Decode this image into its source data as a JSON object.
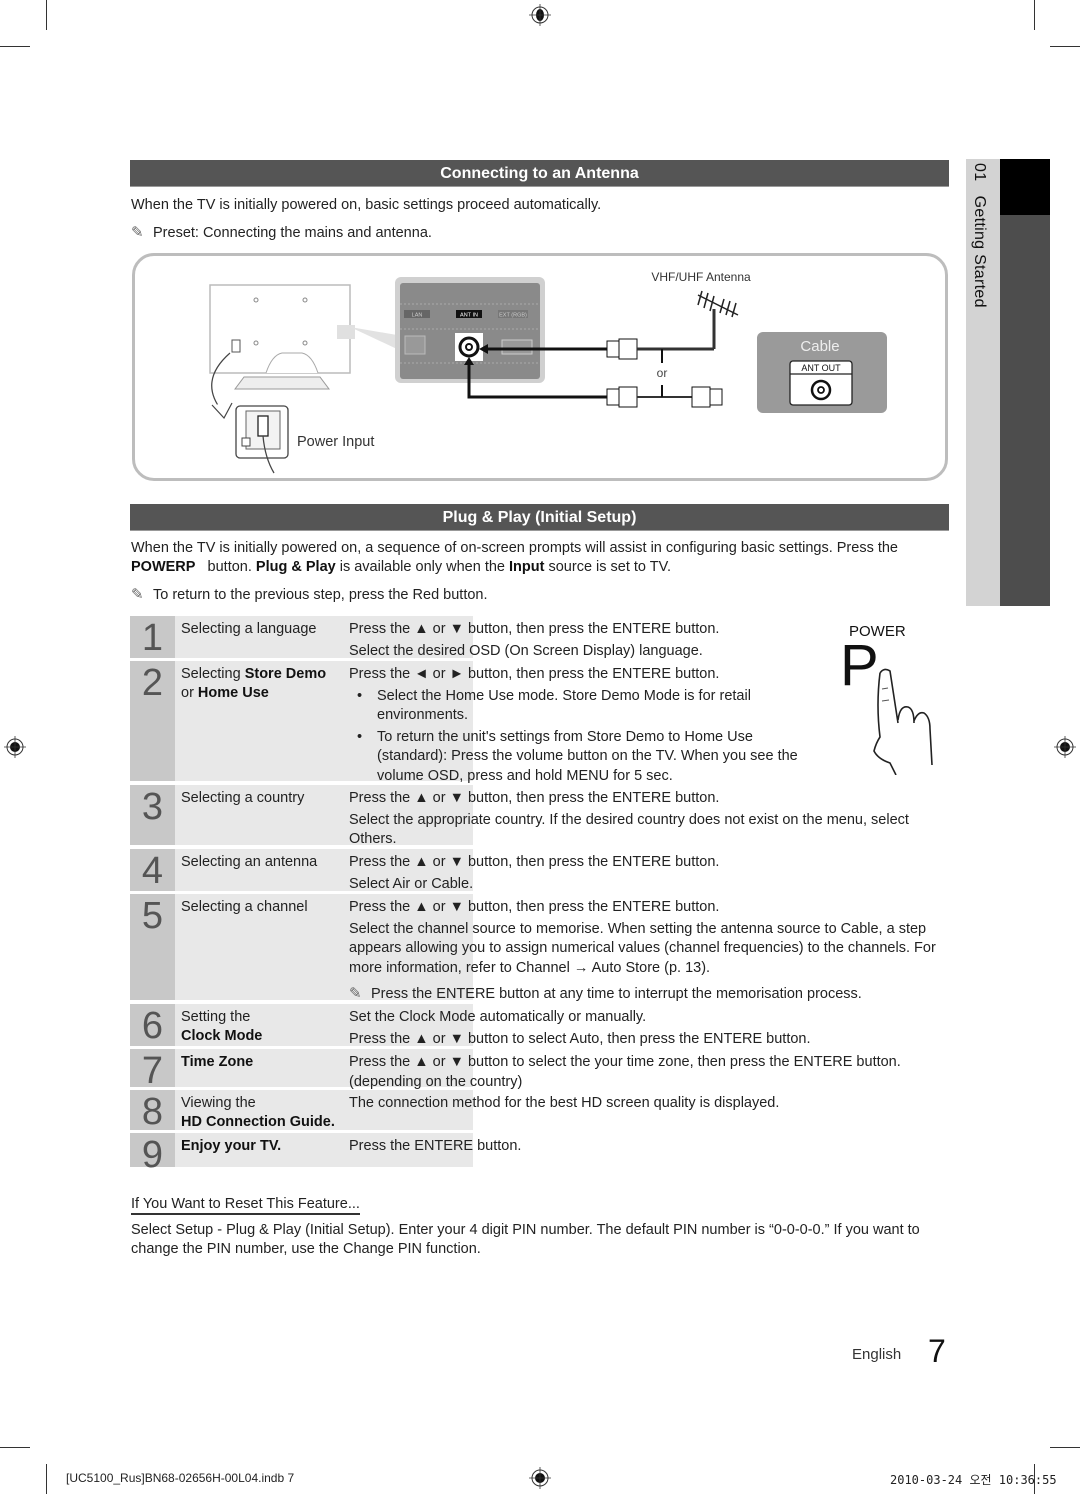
{
  "sidebar": {
    "chapter_number": "01",
    "chapter_title": "Getting Started"
  },
  "antenna_section": {
    "title": "Connecting to an Antenna",
    "intro": "When the TV is initially powered on, basic settings proceed automatically.",
    "note": "Preset: Connecting the mains and antenna.",
    "diagram": {
      "port_labels": [
        "LAN",
        "ANT IN",
        "EXT (RGB)"
      ],
      "antenna_label": "VHF/UHF Antenna",
      "or_label": "or",
      "cable_label": "Cable",
      "ant_out_label": "ANT OUT",
      "power_input_label": "Power Input"
    }
  },
  "plug_play_section": {
    "title": "Plug & Play (Initial Setup)",
    "intro_1": "When the TV is initially powered on, a sequence of on-screen prompts will assist in configuring basic settings. Press the",
    "intro_power": "POWERP",
    "intro_2": "button.",
    "intro_plug": "Plug & Play",
    "intro_3": "is available only when the",
    "intro_input": "Input",
    "intro_4": "source is set to TV.",
    "note": "To return to the previous step, press the Red button.",
    "power_label": "POWER",
    "power_glyph": "P"
  },
  "steps": [
    {
      "number": "1",
      "title": "Selecting a language",
      "lines": [
        "Press the ▲ or ▼ button, then press the ENTERE    button.",
        "Select the desired OSD (On Screen Display) language."
      ]
    },
    {
      "number": "2",
      "title_1": "Selecting ",
      "title_bold_1": "Store Demo",
      "title_2": "or ",
      "title_bold_2": "Home Use",
      "line": "Press the ◄ or ► button, then press the ENTERE    button.",
      "bullet_1": "Select the Home Use mode. Store Demo Mode is for retail environments.",
      "bullet_2": "To return the unit's settings from Store Demo to Home Use (standard): Press the volume button on the TV. When you see the volume OSD, press and hold MENU for 5 sec."
    },
    {
      "number": "3",
      "title": "Selecting a country",
      "lines": [
        "Press the ▲ or ▼ button, then press the ENTERE    button.",
        "Select the appropriate country. If the desired country does not exist on the menu, select Others."
      ]
    },
    {
      "number": "4",
      "title": "Selecting an antenna",
      "lines": [
        "Press the ▲ or ▼ button, then press the ENTERE    button.",
        "Select Air or Cable."
      ]
    },
    {
      "number": "5",
      "title": "Selecting a channel",
      "lines": [
        "Press the ▲ or ▼ button, then press the ENTERE    button.",
        "Select the channel source to memorise. When setting the antenna source to Cable, a step appears allowing you to assign numerical values (channel frequencies) to the channels. For more information, refer to Channel → Auto Store (p. 13)."
      ],
      "note": "Press the ENTERE    button at any time to interrupt the memorisation process."
    },
    {
      "number": "6",
      "title_1": "Setting the",
      "title_bold": "Clock Mode",
      "lines": [
        "Set the Clock Mode automatically or manually.",
        "Press the ▲ or ▼ button to select Auto, then press the ENTERE    button."
      ]
    },
    {
      "number": "7",
      "title_bold": "Time Zone",
      "lines": [
        "Press the ▲ or ▼ button to select the your time zone, then press the ENTERE    button. (depending on the country)"
      ]
    },
    {
      "number": "8",
      "title_1": "Viewing the",
      "title_bold": "HD Connection Guide.",
      "lines": [
        "The connection method for the best HD screen quality is displayed."
      ]
    },
    {
      "number": "9",
      "title_bold": "Enjoy your TV.",
      "lines": [
        "Press the ENTERE    button."
      ]
    }
  ],
  "reset": {
    "heading": "If You Want to Reset This Feature...",
    "text": "Select Setup - Plug & Play (Initial Setup). Enter your 4 digit PIN number. The default PIN number is “0-0-0-0.” If you want to change the PIN number, use the Change PIN function."
  },
  "page": {
    "language": "English",
    "number": "7"
  },
  "footer": {
    "file": "[UC5100_Rus]BN68-02656H-00L04.indb   7",
    "timestamp": "2010-03-24   오전 10:36:55"
  }
}
